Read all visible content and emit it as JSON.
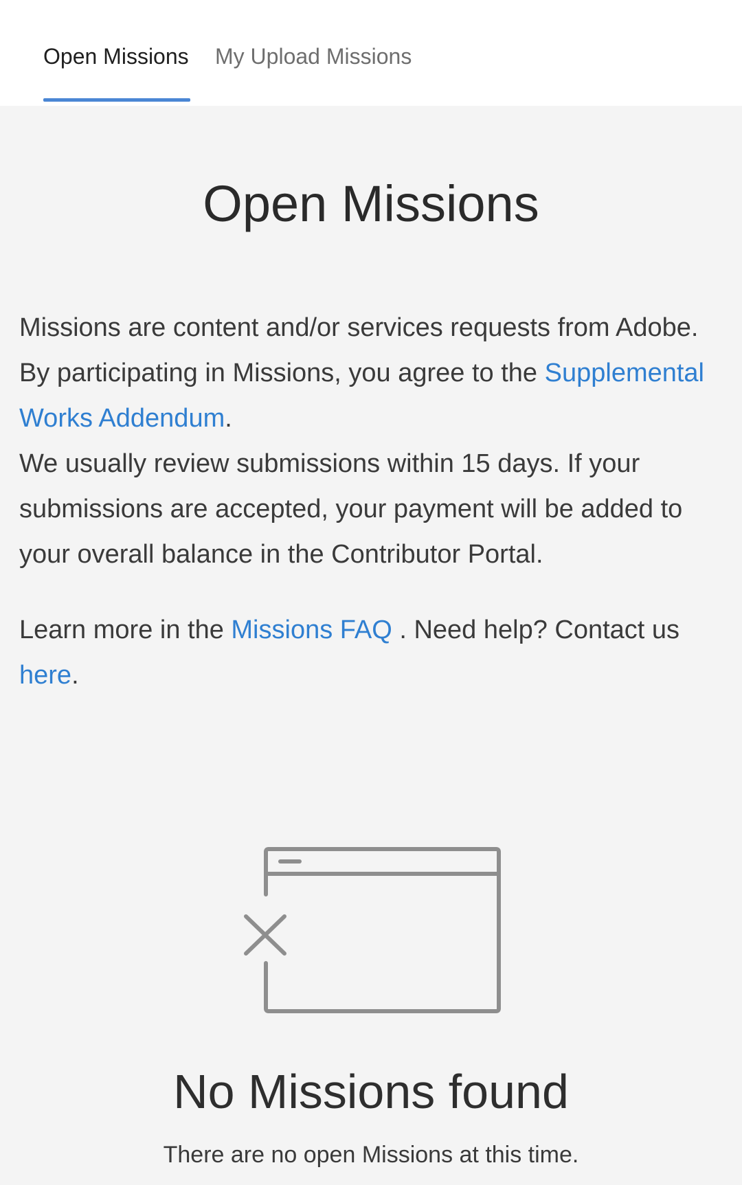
{
  "tabs": {
    "open_missions": "Open Missions",
    "my_upload_missions": "My Upload Missions",
    "active": "Open Missions"
  },
  "page": {
    "title": "Open Missions"
  },
  "intro": {
    "line1": "Missions are content and/or services requests from Adobe.",
    "line2_prefix": "By participating in Missions, you agree to the ",
    "addendum_link": "Supplemental Works Addendum",
    "line2_suffix": ".",
    "line3": "We usually review submissions within 15 days. If your submissions are accepted, your payment will be added to your overall balance in the Contributor Portal.",
    "learn_prefix": "Learn more in the ",
    "faq_link": "Missions FAQ",
    "learn_middle": " . Need help? Contact us ",
    "here_link": "here",
    "learn_suffix": "."
  },
  "empty_state": {
    "icon": "empty-window-icon",
    "title": "No Missions found",
    "subtitle": "There are no open Missions at this time."
  },
  "colors": {
    "accent": "#4a86d4",
    "link": "#2f7fd1",
    "background": "#f4f4f4",
    "tabbar": "#ffffff"
  }
}
